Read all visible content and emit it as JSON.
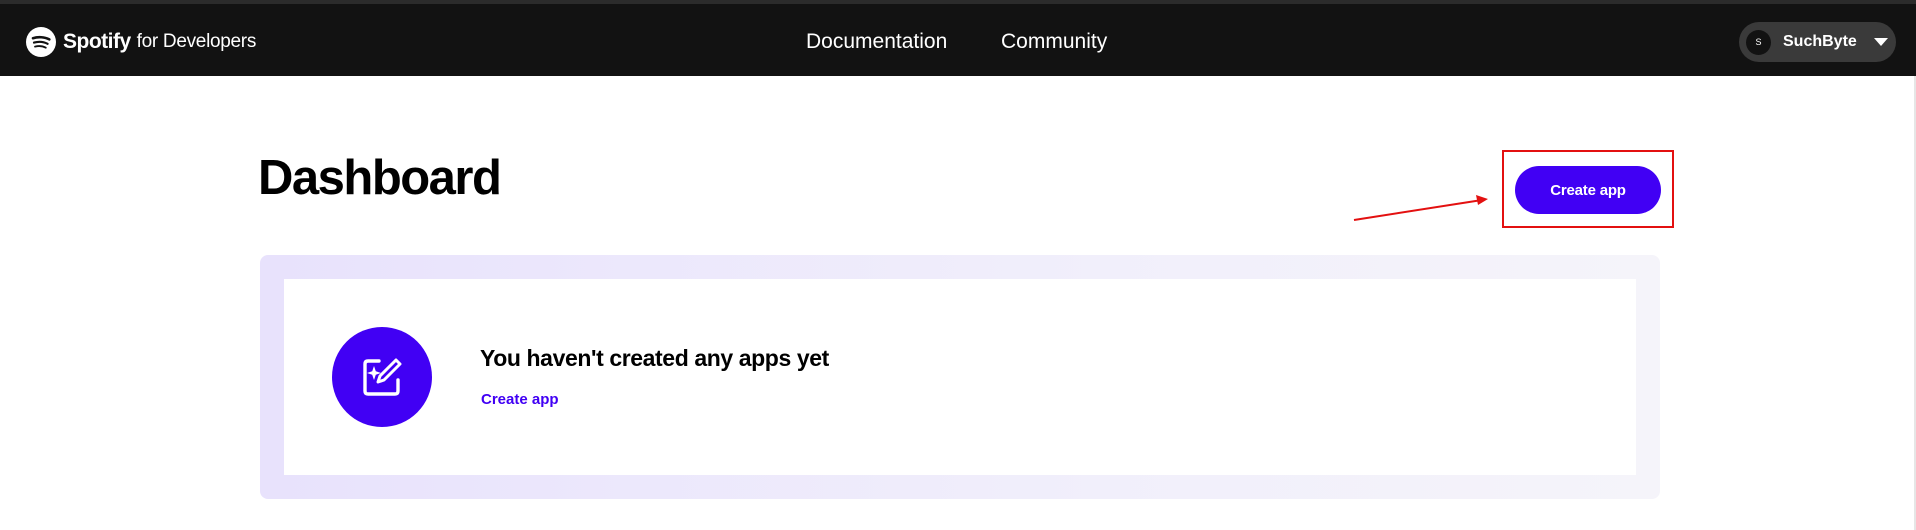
{
  "header": {
    "logo_word": "Spotify",
    "logo_sub": "for Developers",
    "nav": {
      "documentation": "Documentation",
      "community": "Community"
    },
    "user": {
      "avatar_initial": "S",
      "name": "SuchByte"
    }
  },
  "main": {
    "title": "Dashboard",
    "create_button": "Create app",
    "empty_state": {
      "icon": "edit-sparkle-icon",
      "title": "You haven't created any apps yet",
      "link": "Create app"
    }
  },
  "colors": {
    "accent": "#4100f4",
    "navbar": "#121212",
    "annotation": "#e31010"
  }
}
